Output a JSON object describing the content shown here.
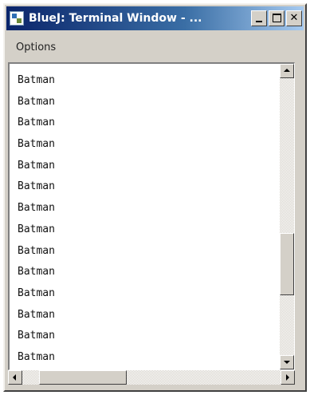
{
  "window": {
    "title": "BlueJ: Terminal Window - ..."
  },
  "menubar": {
    "items": [
      {
        "label": "Options"
      }
    ]
  },
  "terminal": {
    "lines": [
      "Batman",
      "Batman",
      "Batman",
      "Batman",
      "Batman",
      "Batman",
      "Batman",
      "Batman",
      "Batman",
      "Batman",
      "Batman",
      "Batman",
      "Batman",
      "Batman"
    ]
  },
  "scroll": {
    "vertical_position": 0.72,
    "horizontal_position": 0.1
  },
  "icons": {
    "app": "bluej-app-icon",
    "minimize": "minimize-icon",
    "maximize": "maximize-icon",
    "close": "close-icon"
  },
  "colors": {
    "titlebar_start": "#0a246a",
    "titlebar_end": "#a6caf0",
    "chrome": "#d4d0c8",
    "terminal_bg": "#ffffff"
  }
}
